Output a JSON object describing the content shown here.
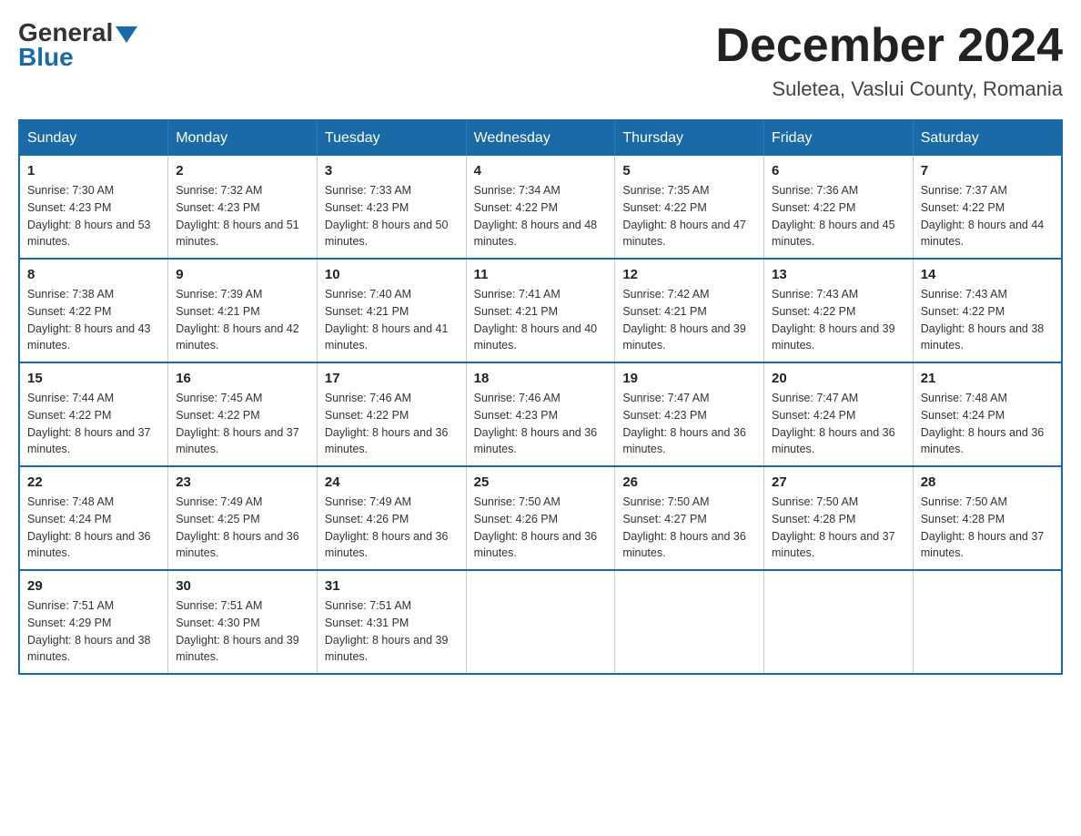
{
  "header": {
    "logo_general": "General",
    "logo_blue": "Blue",
    "title": "December 2024",
    "location": "Suletea, Vaslui County, Romania"
  },
  "days_of_week": [
    "Sunday",
    "Monday",
    "Tuesday",
    "Wednesday",
    "Thursday",
    "Friday",
    "Saturday"
  ],
  "weeks": [
    [
      {
        "day": "1",
        "sunrise": "7:30 AM",
        "sunset": "4:23 PM",
        "daylight": "8 hours and 53 minutes."
      },
      {
        "day": "2",
        "sunrise": "7:32 AM",
        "sunset": "4:23 PM",
        "daylight": "8 hours and 51 minutes."
      },
      {
        "day": "3",
        "sunrise": "7:33 AM",
        "sunset": "4:23 PM",
        "daylight": "8 hours and 50 minutes."
      },
      {
        "day": "4",
        "sunrise": "7:34 AM",
        "sunset": "4:22 PM",
        "daylight": "8 hours and 48 minutes."
      },
      {
        "day": "5",
        "sunrise": "7:35 AM",
        "sunset": "4:22 PM",
        "daylight": "8 hours and 47 minutes."
      },
      {
        "day": "6",
        "sunrise": "7:36 AM",
        "sunset": "4:22 PM",
        "daylight": "8 hours and 45 minutes."
      },
      {
        "day": "7",
        "sunrise": "7:37 AM",
        "sunset": "4:22 PM",
        "daylight": "8 hours and 44 minutes."
      }
    ],
    [
      {
        "day": "8",
        "sunrise": "7:38 AM",
        "sunset": "4:22 PM",
        "daylight": "8 hours and 43 minutes."
      },
      {
        "day": "9",
        "sunrise": "7:39 AM",
        "sunset": "4:21 PM",
        "daylight": "8 hours and 42 minutes."
      },
      {
        "day": "10",
        "sunrise": "7:40 AM",
        "sunset": "4:21 PM",
        "daylight": "8 hours and 41 minutes."
      },
      {
        "day": "11",
        "sunrise": "7:41 AM",
        "sunset": "4:21 PM",
        "daylight": "8 hours and 40 minutes."
      },
      {
        "day": "12",
        "sunrise": "7:42 AM",
        "sunset": "4:21 PM",
        "daylight": "8 hours and 39 minutes."
      },
      {
        "day": "13",
        "sunrise": "7:43 AM",
        "sunset": "4:22 PM",
        "daylight": "8 hours and 39 minutes."
      },
      {
        "day": "14",
        "sunrise": "7:43 AM",
        "sunset": "4:22 PM",
        "daylight": "8 hours and 38 minutes."
      }
    ],
    [
      {
        "day": "15",
        "sunrise": "7:44 AM",
        "sunset": "4:22 PM",
        "daylight": "8 hours and 37 minutes."
      },
      {
        "day": "16",
        "sunrise": "7:45 AM",
        "sunset": "4:22 PM",
        "daylight": "8 hours and 37 minutes."
      },
      {
        "day": "17",
        "sunrise": "7:46 AM",
        "sunset": "4:22 PM",
        "daylight": "8 hours and 36 minutes."
      },
      {
        "day": "18",
        "sunrise": "7:46 AM",
        "sunset": "4:23 PM",
        "daylight": "8 hours and 36 minutes."
      },
      {
        "day": "19",
        "sunrise": "7:47 AM",
        "sunset": "4:23 PM",
        "daylight": "8 hours and 36 minutes."
      },
      {
        "day": "20",
        "sunrise": "7:47 AM",
        "sunset": "4:24 PM",
        "daylight": "8 hours and 36 minutes."
      },
      {
        "day": "21",
        "sunrise": "7:48 AM",
        "sunset": "4:24 PM",
        "daylight": "8 hours and 36 minutes."
      }
    ],
    [
      {
        "day": "22",
        "sunrise": "7:48 AM",
        "sunset": "4:24 PM",
        "daylight": "8 hours and 36 minutes."
      },
      {
        "day": "23",
        "sunrise": "7:49 AM",
        "sunset": "4:25 PM",
        "daylight": "8 hours and 36 minutes."
      },
      {
        "day": "24",
        "sunrise": "7:49 AM",
        "sunset": "4:26 PM",
        "daylight": "8 hours and 36 minutes."
      },
      {
        "day": "25",
        "sunrise": "7:50 AM",
        "sunset": "4:26 PM",
        "daylight": "8 hours and 36 minutes."
      },
      {
        "day": "26",
        "sunrise": "7:50 AM",
        "sunset": "4:27 PM",
        "daylight": "8 hours and 36 minutes."
      },
      {
        "day": "27",
        "sunrise": "7:50 AM",
        "sunset": "4:28 PM",
        "daylight": "8 hours and 37 minutes."
      },
      {
        "day": "28",
        "sunrise": "7:50 AM",
        "sunset": "4:28 PM",
        "daylight": "8 hours and 37 minutes."
      }
    ],
    [
      {
        "day": "29",
        "sunrise": "7:51 AM",
        "sunset": "4:29 PM",
        "daylight": "8 hours and 38 minutes."
      },
      {
        "day": "30",
        "sunrise": "7:51 AM",
        "sunset": "4:30 PM",
        "daylight": "8 hours and 39 minutes."
      },
      {
        "day": "31",
        "sunrise": "7:51 AM",
        "sunset": "4:31 PM",
        "daylight": "8 hours and 39 minutes."
      },
      null,
      null,
      null,
      null
    ]
  ]
}
